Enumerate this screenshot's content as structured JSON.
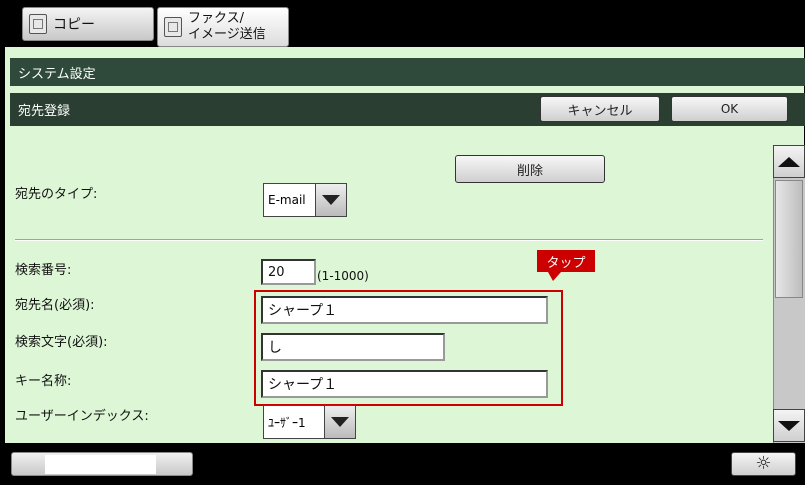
{
  "tabs": [
    {
      "label": "コピー"
    },
    {
      "label_line1": "ファクス/",
      "label_line2": "イメージ送信"
    }
  ],
  "header": {
    "title": "システム設定",
    "subtitle": "宛先登録",
    "cancel_label": "キャンセル",
    "ok_label": "OK"
  },
  "form": {
    "delete_label": "削除",
    "dest_type_label": "宛先のタイプ:",
    "dest_type_value": "E-mail",
    "search_no_label": "検索番号:",
    "search_no_value": "20",
    "search_no_range": "(1-1000)",
    "dest_name_label": "宛先名(必須):",
    "dest_name_value": "シャープ１",
    "search_char_label": "検索文字(必須):",
    "search_char_value": "し",
    "key_name_label": "キー名称:",
    "key_name_value": "シャープ１",
    "user_index_label": "ユーザーインデックス:",
    "user_index_value": "ﾕｰｻﾞｰ1"
  },
  "callout": {
    "label": "タップ",
    "color": "#cc0000"
  },
  "colors": {
    "pane_bg": "#ddf6d6",
    "header_bg": "#2f4a3a",
    "highlight": "#cc0000"
  }
}
